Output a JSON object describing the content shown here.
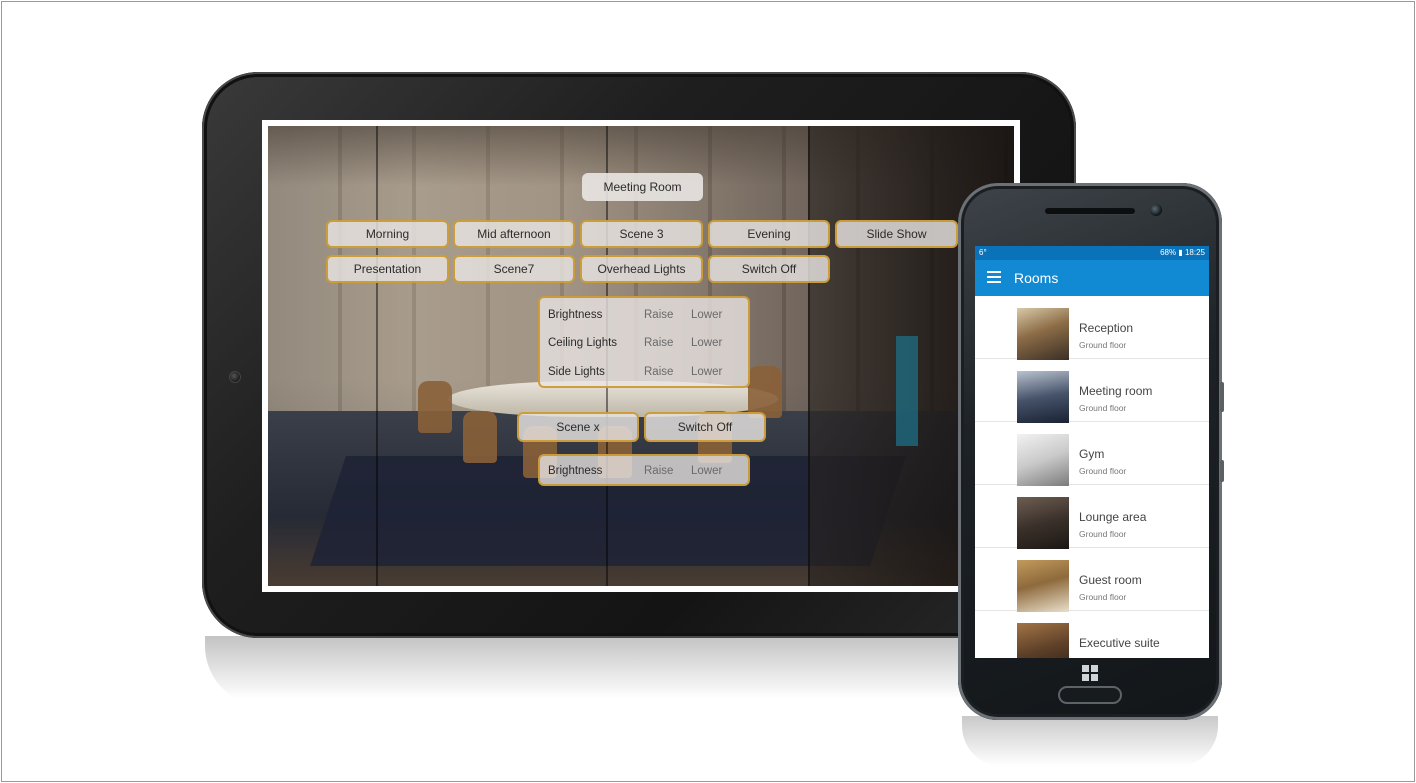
{
  "tablet": {
    "room_title": "Meeting Room",
    "scenes": [
      "Morning",
      "Mid afternoon",
      "Scene 3",
      "Evening",
      "Slide Show",
      "Presentation",
      "Scene7",
      "Overhead Lights",
      "Switch Off"
    ],
    "light_controls": [
      {
        "label": "Brightness",
        "raise": "Raise",
        "lower": "Lower"
      },
      {
        "label": "Ceiling Lights",
        "raise": "Raise",
        "lower": "Lower"
      },
      {
        "label": "Side Lights",
        "raise": "Raise",
        "lower": "Lower"
      }
    ],
    "secondary_buttons": [
      "Scene x",
      "Switch Off"
    ],
    "secondary_control": {
      "label": "Brightness",
      "raise": "Raise",
      "lower": "Lower"
    }
  },
  "phone": {
    "status": {
      "left": "6°",
      "right": "68% ▮ 18:25"
    },
    "app_title": "Rooms",
    "accent_color": "#1189d3",
    "rooms": [
      {
        "name": "Reception",
        "floor": "Ground floor"
      },
      {
        "name": "Meeting room",
        "floor": "Ground floor"
      },
      {
        "name": "Gym",
        "floor": "Ground floor"
      },
      {
        "name": "Lounge area",
        "floor": "Ground floor"
      },
      {
        "name": "Guest room",
        "floor": "Ground floor"
      },
      {
        "name": "Executive suite",
        "floor": ""
      }
    ]
  }
}
